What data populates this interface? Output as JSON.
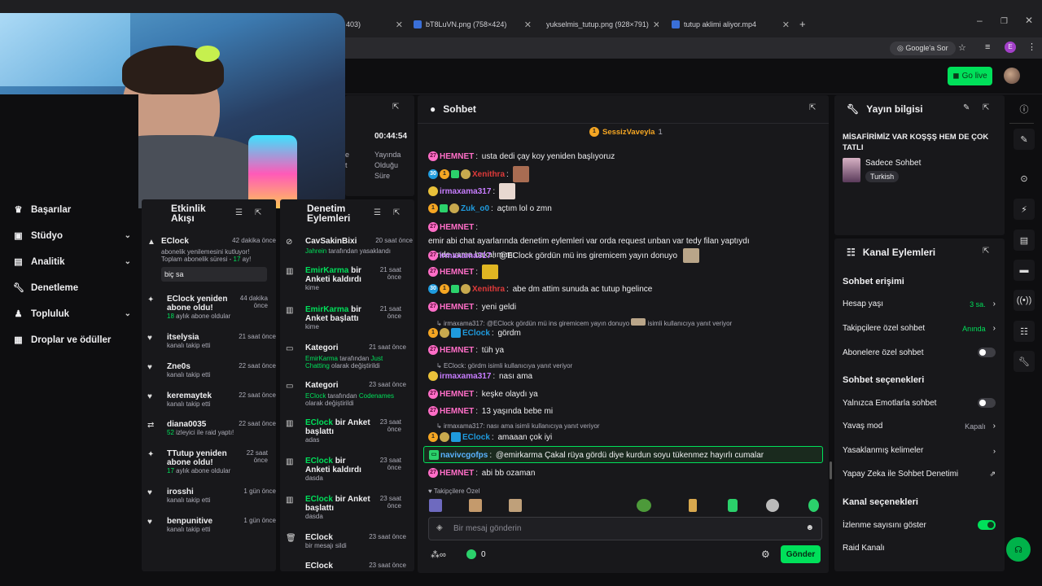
{
  "browser": {
    "tabs": [
      {
        "label": "403)"
      },
      {
        "label": "bT8LuVN.png (758×424)"
      },
      {
        "label": "yukselmis_tutup.png (928×791)"
      },
      {
        "label": "tutup aklimi aliyor.mp4"
      }
    ],
    "new_tab": "+",
    "ask_google": "Google'a Sor",
    "profile_letter": "E"
  },
  "topnav": {
    "go_live": "Go live"
  },
  "leftnav": {
    "items": [
      {
        "label": "Başarılar",
        "icon": "trophy-icon"
      },
      {
        "label": "Stüdyo",
        "icon": "studio-icon"
      },
      {
        "label": "Analitik",
        "icon": "analytics-icon"
      },
      {
        "label": "Denetleme",
        "icon": "wrench-icon"
      },
      {
        "label": "Topluluk",
        "icon": "community-icon"
      },
      {
        "label": "Droplar ve ödüller",
        "icon": "gift-icon"
      }
    ]
  },
  "stream_stats": {
    "time": "00:44:54",
    "label_line1": "Yayında",
    "label_line2": "Olduğu",
    "label_line3": "Süre",
    "cut_text_1": "e",
    "cut_text_2": "t"
  },
  "activity": {
    "title_line1": "Etkinlik",
    "title_line2": "Akışı",
    "items": [
      {
        "name": "EClock",
        "time": "42 dakika önce",
        "desc": "abonelik yenilemesini kutluyor! Toplam abonelik süresi -",
        "months": "17",
        "months_suffix": "ay!",
        "message": "biç sa"
      },
      {
        "name": "EClock yeniden abone oldu!",
        "time": "44 dakika önce",
        "months": "18",
        "desc": "aylık abone oldular"
      },
      {
        "name": "itselysia",
        "time": "21 saat önce",
        "desc": "kanalı takip etti"
      },
      {
        "name": "Zne0s",
        "time": "22 saat önce",
        "desc": "kanalı takip etti"
      },
      {
        "name": "keremaytek",
        "time": "22 saat önce",
        "desc": "kanalı takip etti"
      },
      {
        "name": "diana0035",
        "time": "22 saat önce",
        "count": "52",
        "desc": "izleyici ile raid yaptı!"
      },
      {
        "name": "TTutup yeniden abone oldu!",
        "time": "22 saat önce",
        "months": "17",
        "desc": "aylık abone oldular"
      },
      {
        "name": "irosshi",
        "time": "1 gün önce",
        "desc": "kanalı takip etti"
      },
      {
        "name": "benpunitive",
        "time": "1 gün önce",
        "desc": "kanalı takip etti"
      }
    ]
  },
  "moderation": {
    "title_line1": "Denetim",
    "title_line2": "Eylemleri",
    "items": [
      {
        "actor": "CavSakinBixi",
        "rest": "",
        "time": "20 saat önce",
        "sub_a": "Jahrein",
        "sub_b": "tarafından yasaklandı"
      },
      {
        "actor": "EmirKarma",
        "rest": "bir Anketi kaldırdı",
        "time": "21 saat önce",
        "sub_b": "kime"
      },
      {
        "actor": "EmirKarma",
        "rest": "bir Anket başlattı",
        "time": "21 saat önce",
        "sub_b": "kime"
      },
      {
        "actor": "Kategori",
        "rest": "",
        "time": "21 saat önce",
        "sub_a": "EmirKarma",
        "sub_b": "tarafından",
        "sub_c": "Just Chatting",
        "sub_d": "olarak değiştirildi"
      },
      {
        "actor": "Kategori",
        "rest": "",
        "time": "23 saat önce",
        "sub_a": "EClock",
        "sub_b": "tarafından",
        "sub_c": "Codenames",
        "sub_d": "olarak değiştirildi"
      },
      {
        "actor": "EClock",
        "rest": "bir Anket başlattı",
        "time": "23 saat önce",
        "sub_b": "adas"
      },
      {
        "actor": "EClock",
        "rest": "bir Anketi kaldırdı",
        "time": "23 saat önce",
        "sub_b": "dasda"
      },
      {
        "actor": "EClock",
        "rest": "bir Anket başlattı",
        "time": "23 saat önce",
        "sub_b": "dasda"
      },
      {
        "actor": "EClock",
        "rest": "",
        "time": "23 saat önce",
        "sub_b": "bir mesajı sildi"
      },
      {
        "actor": "EClock",
        "rest": "",
        "time": "23 saat önce",
        "sub_b": ""
      }
    ]
  },
  "chat": {
    "title": "Sohbet",
    "pinned_user": "SessizVaveyla",
    "pinned_count": "1",
    "messages": [
      {
        "user": "HEMNET",
        "color": "#ff6ec7",
        "text": "usta dedi çay koy yeniden başlıyoruz"
      },
      {
        "user": "Xenithra",
        "color": "#e03a3a",
        "text": ""
      },
      {
        "user": "irmaxama317",
        "color": "#c77dff",
        "text": ""
      },
      {
        "user": "Zuk_o0",
        "color": "#1f9bde",
        "text": "açtım lol o zmn"
      },
      {
        "user": "HEMNET",
        "color": "#ff6ec7",
        "text": "emir abi chat ayarlarında denetim eylemleri var orda request unban var tedy filan yaptıydı",
        "text2": "sende varsa bakalım mı"
      },
      {
        "user": "irmaxama317",
        "color": "#c77dff",
        "text": "@EClock gördün mü ins giremicem yayın donuyo"
      },
      {
        "user": "HEMNET",
        "color": "#ff6ec7",
        "text": ""
      },
      {
        "user": "Xenithra",
        "color": "#e03a3a",
        "text": "abe dm attim sunuda ac tutup hgelince"
      },
      {
        "user": "HEMNET",
        "color": "#ff6ec7",
        "text": "yeni geldi"
      },
      {
        "reply": "irmaxama317: @EClock gördün mü ins giremicem yayın donuyo",
        "reply_suffix": "isimli kullanıcıya yanıt veriyor"
      },
      {
        "user": "EClock",
        "color": "#1f9bde",
        "text": "gördm"
      },
      {
        "user": "HEMNET",
        "color": "#ff6ec7",
        "text": "tüh ya"
      },
      {
        "reply": "EClock: gördm isimli kullanıcıya yanıt veriyor"
      },
      {
        "user": "irmaxama317",
        "color": "#c77dff",
        "text": "nası ama"
      },
      {
        "user": "HEMNET",
        "color": "#ff6ec7",
        "text": "keşke olaydı ya"
      },
      {
        "user": "HEMNET",
        "color": "#ff6ec7",
        "text": "13 yaşında bebe mi"
      },
      {
        "reply": "irmaxama317: nası ama isimli kullanıcıya yanıt veriyor"
      },
      {
        "user": "EClock",
        "color": "#1f9bde",
        "text": "amaaan çok iyi"
      },
      {
        "user": "navivcgofps",
        "color": "#5ab3ff",
        "text": "@emirkarma Çakal rüya gördü diye kurdun soyu tükenmez hayırlı cumalar"
      },
      {
        "user": "HEMNET",
        "color": "#ff6ec7",
        "text": "abi bb ozaman"
      }
    ],
    "followers_only": "Takipçilere Özel",
    "placeholder": "Bir mesaj gönderin",
    "points": "0",
    "send": "Gönder"
  },
  "stream_info": {
    "title": "Yayın bilgisi",
    "stream_title": "MİSAFİRİMİZ VAR KOŞŞŞ HEM DE ÇOK TATLI",
    "category": "Sadece Sohbet",
    "language": "Turkish"
  },
  "channel_actions": {
    "title": "Kanal Eylemleri",
    "chat_access": "Sohbet erişimi",
    "account_age": "Hesap yaşı",
    "account_age_val": "3 sa.",
    "followers_only": "Takipçilere özel sohbet",
    "followers_only_val": "Anında",
    "subs_only": "Abonelere özel sohbet",
    "chat_options": "Sohbet seçenekleri",
    "emote_only": "Yalnızca Emotlarla sohbet",
    "slow_mode": "Yavaş mod",
    "slow_mode_val": "Kapalı",
    "banned_words": "Yasaklanmış kelimeler",
    "ai_moderation": "Yapay Zeka ile Sohbet Denetimi",
    "channel_options": "Kanal seçenekleri",
    "show_viewers": "İzlenme sayısını göster",
    "raid_channel": "Raid Kanalı"
  },
  "colors": {
    "accent": "#00e05a",
    "bg": "#0e0e10",
    "panel": "#18181b"
  }
}
